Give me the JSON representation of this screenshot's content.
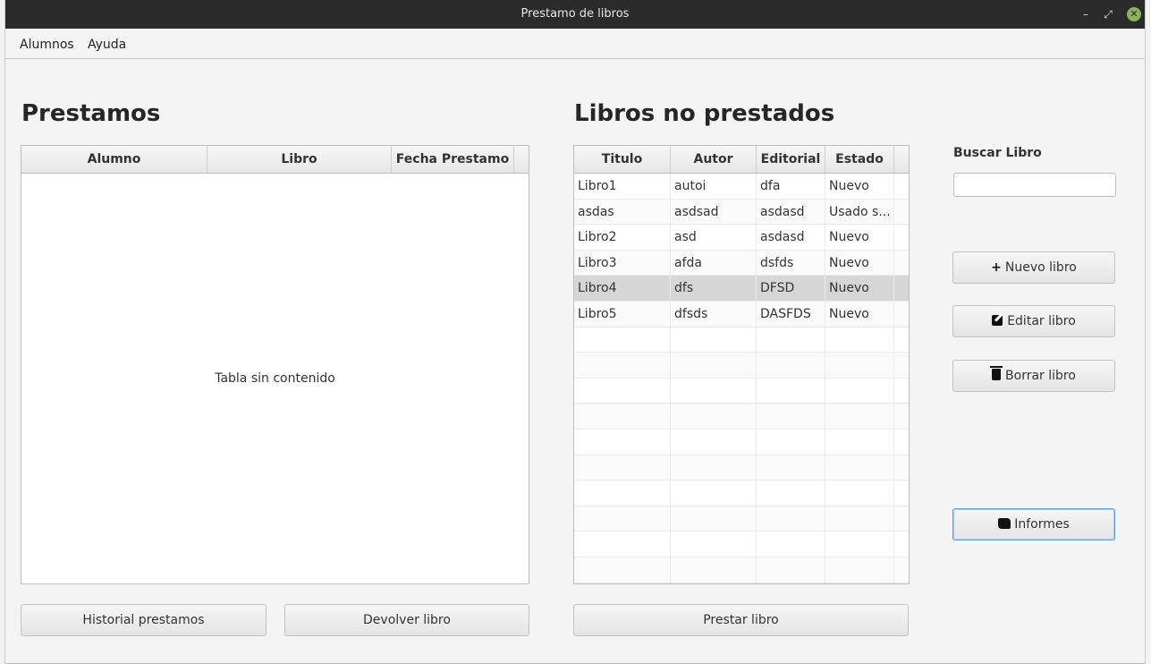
{
  "window": {
    "title": "Prestamo de libros",
    "min_glyph": "–",
    "max_glyph": "⤢",
    "close_glyph": "✕"
  },
  "menu": {
    "items": [
      "Alumnos",
      "Ayuda"
    ]
  },
  "prestamos": {
    "title": "Prestamos",
    "columns": [
      "Alumno",
      "Libro",
      "Fecha Prestamo"
    ],
    "empty_text": "Tabla sin contenido"
  },
  "libros": {
    "title": "Libros no prestados",
    "columns": [
      "Titulo",
      "Autor",
      "Editorial",
      "Estado"
    ],
    "rows": [
      {
        "titulo": "Libro1",
        "autor": "autoi",
        "editorial": "dfa",
        "estado": "Nuevo"
      },
      {
        "titulo": "asdas",
        "autor": "asdsad",
        "editorial": "asdasd",
        "estado": "Usado s..."
      },
      {
        "titulo": "Libro2",
        "autor": "asd",
        "editorial": "asdasd",
        "estado": "Nuevo"
      },
      {
        "titulo": "Libro3",
        "autor": "afda",
        "editorial": "dsfds",
        "estado": "Nuevo"
      },
      {
        "titulo": "Libro4",
        "autor": "dfs",
        "editorial": "DFSD",
        "estado": "Nuevo",
        "selected": true
      },
      {
        "titulo": "Libro5",
        "autor": "dfsds",
        "editorial": "DASFDS",
        "estado": "Nuevo"
      }
    ]
  },
  "buscar": {
    "label": "Buscar Libro",
    "value": ""
  },
  "buttons": {
    "nuevo": "Nuevo libro",
    "editar": "Editar libro",
    "borrar": "Borrar libro",
    "informes": "Informes",
    "historial": "Historial prestamos",
    "devolver": "Devolver libro",
    "prestar": "Prestar libro"
  },
  "icons": {
    "nuevo": "plus-icon",
    "editar": "edit-icon",
    "borrar": "trash-icon",
    "informes": "scroll-icon"
  }
}
